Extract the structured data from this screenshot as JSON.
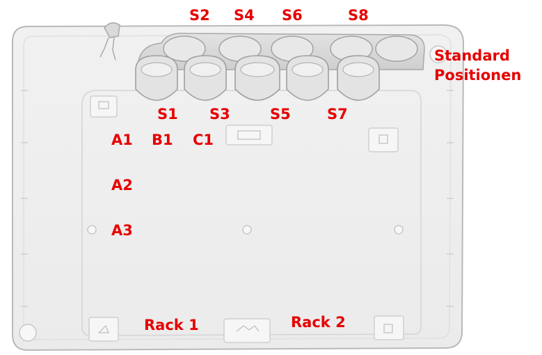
{
  "label_color": "#e60000",
  "standard_positions": {
    "top_row": [
      "S2",
      "S4",
      "S6",
      "S8"
    ],
    "bottom_row": [
      "S1",
      "S3",
      "S5",
      "S7"
    ],
    "caption_line1": "Standard",
    "caption_line2": "Positionen"
  },
  "sample_positions": {
    "row1": [
      "A1",
      "B1",
      "C1"
    ],
    "column": [
      "A2",
      "A3"
    ]
  },
  "racks": [
    "Rack 1",
    "Rack 2"
  ]
}
